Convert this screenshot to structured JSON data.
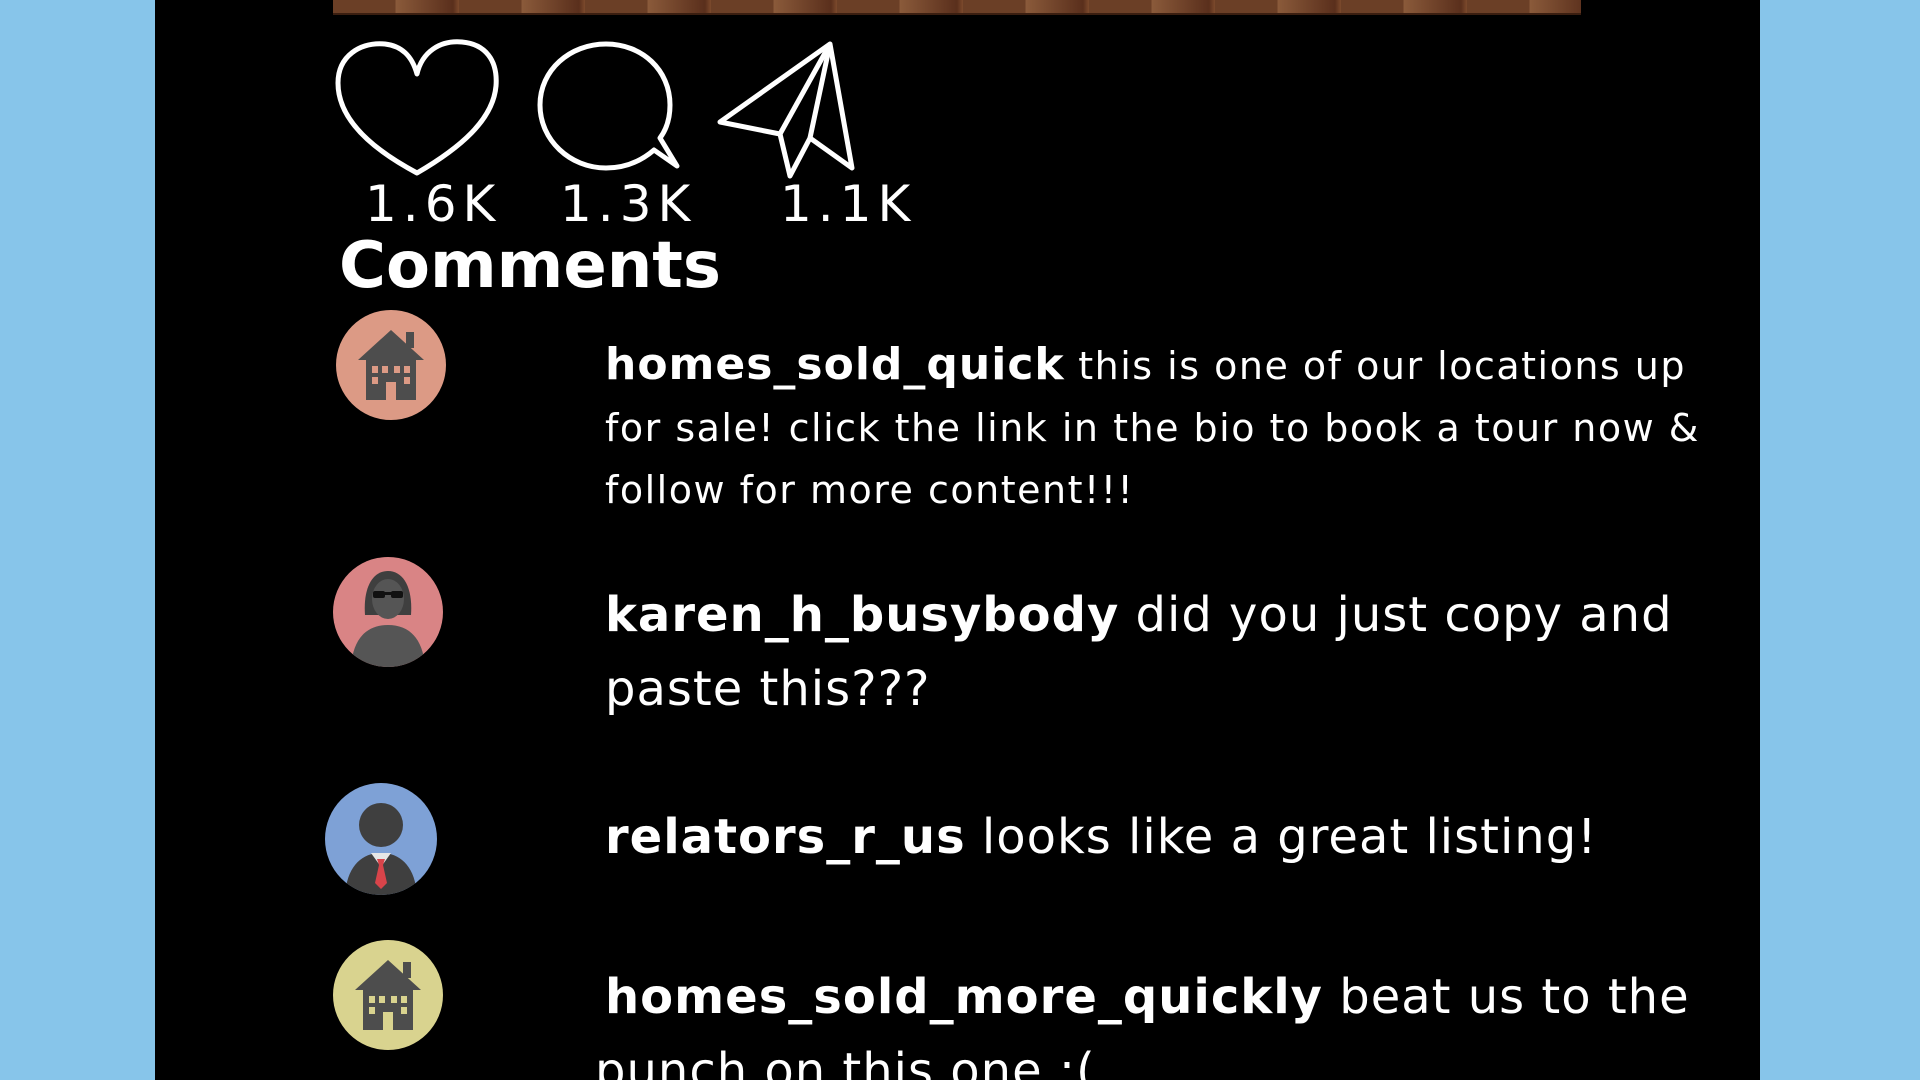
{
  "post": {
    "like_count": "1.6K",
    "comment_count": "1.3K",
    "share_count": "1.1K",
    "comments_heading": "Comments"
  },
  "comments": [
    {
      "user": "homes_sold_quick",
      "text": " this is one of our locations up for sale! click the link in the bio to book a tour now & follow for more content!!!",
      "avatar_color": "#dc9a85",
      "avatar_icon": "house-icon"
    },
    {
      "user": "karen_h_busybody",
      "text": " did you just copy and paste this???",
      "avatar_color": "#d98485",
      "avatar_icon": "woman-sunglasses-icon"
    },
    {
      "user": "relators_r_us",
      "text": " looks like a great listing!",
      "avatar_color": "#7ea1d6",
      "avatar_icon": "businessman-icon"
    },
    {
      "user": "homes_sold_more_quickly",
      "text": " beat us to the punch on this one :(",
      "avatar_color": "#d9d38f",
      "avatar_icon": "house-icon"
    }
  ],
  "colors": {
    "background": "#87c5ea",
    "panel": "#000000",
    "text": "#ffffff"
  }
}
